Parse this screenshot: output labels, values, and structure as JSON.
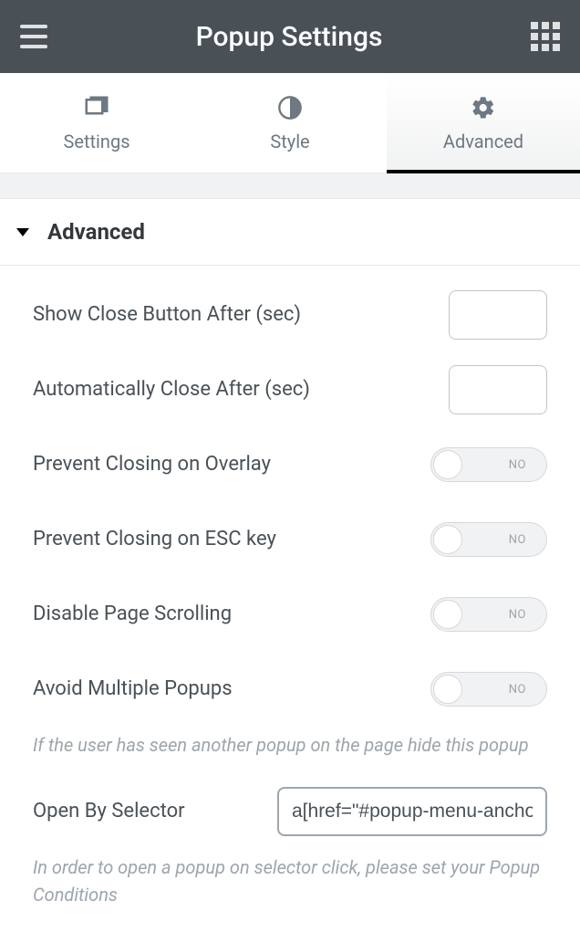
{
  "header": {
    "title": "Popup Settings"
  },
  "tabs": [
    {
      "id": "settings",
      "label": "Settings"
    },
    {
      "id": "style",
      "label": "Style"
    },
    {
      "id": "advanced",
      "label": "Advanced"
    }
  ],
  "activeTab": "advanced",
  "section": {
    "title": "Advanced"
  },
  "fields": {
    "showCloseAfter": {
      "label": "Show Close Button After (sec)",
      "value": ""
    },
    "autoCloseAfter": {
      "label": "Automatically Close After (sec)",
      "value": ""
    },
    "preventOverlay": {
      "label": "Prevent Closing on Overlay",
      "state": "NO"
    },
    "preventEsc": {
      "label": "Prevent Closing on ESC key",
      "state": "NO"
    },
    "disableScroll": {
      "label": "Disable Page Scrolling",
      "state": "NO"
    },
    "avoidMultiple": {
      "label": "Avoid Multiple Popups",
      "state": "NO",
      "help": "If the user has seen another popup on the page hide this popup"
    },
    "openBySelector": {
      "label": "Open By Selector",
      "value": "a[href=\"#popup-menu-anchor\"]",
      "help": "In order to open a popup on selector click, please set your Popup Conditions"
    }
  }
}
